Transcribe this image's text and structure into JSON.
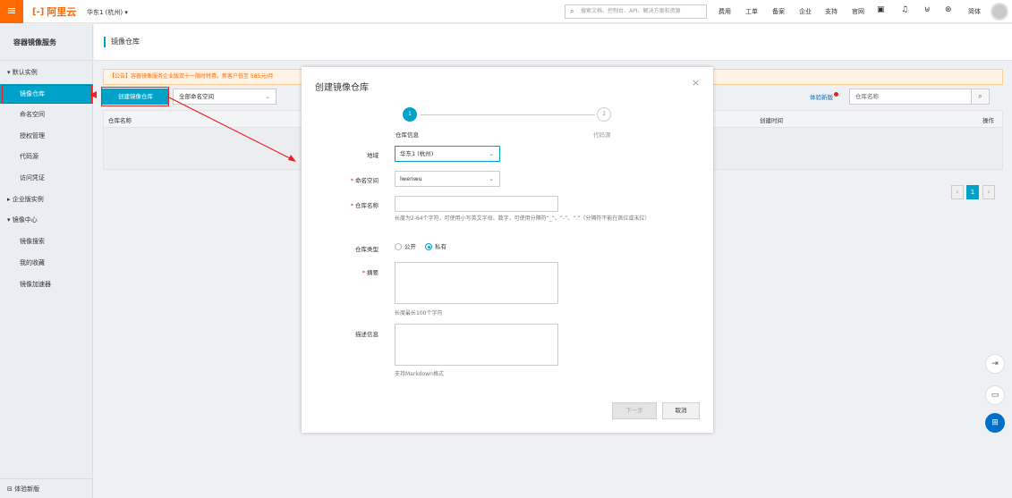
{
  "topbar": {
    "menu_icon": "hamburger-icon",
    "logo_text": "阿里云",
    "region": "华东1 (杭州)",
    "region_caret": "▾",
    "search_placeholder": "搜索文档、控制台、API、解决方案和资源",
    "nav": [
      "费用",
      "工单",
      "备案",
      "企业",
      "支持",
      "官网"
    ],
    "lang": "简体"
  },
  "sidebar": {
    "title": "容器镜像服务",
    "items": [
      {
        "label": "▾ 默认实例",
        "type": "group"
      },
      {
        "label": "镜像仓库",
        "type": "sub",
        "active": true
      },
      {
        "label": "命名空间",
        "type": "sub"
      },
      {
        "label": "授权管理",
        "type": "sub"
      },
      {
        "label": "代码源",
        "type": "sub"
      },
      {
        "label": "访问凭证",
        "type": "sub"
      },
      {
        "label": "▸ 企业版实例",
        "type": "group"
      },
      {
        "label": "▾ 镜像中心",
        "type": "group"
      },
      {
        "label": "镜像搜索",
        "type": "sub"
      },
      {
        "label": "我的收藏",
        "type": "sub"
      },
      {
        "label": "镜像加速器",
        "type": "sub"
      }
    ],
    "footer": "体验新版"
  },
  "main": {
    "page_title": "镜像仓库",
    "notice": "【公告】容器镜像服务企业版双十一限时特惠，新客户低至 585元/月",
    "create_button": "创建镜像仓库",
    "namespace_select": "全部命名空间",
    "try_new": "体验新版",
    "search_placeholder": "仓库名称",
    "table_headers": {
      "name": "仓库名称",
      "created": "创建时间",
      "actions": "操作"
    },
    "pager": {
      "prev": "‹",
      "current": "1",
      "next": "›"
    }
  },
  "modal": {
    "title": "创建镜像仓库",
    "close": "×",
    "steps": [
      {
        "num": "1",
        "label": "仓库信息"
      },
      {
        "num": "2",
        "label": "代码源"
      }
    ],
    "fields": {
      "region_label": "地域",
      "region_value": "华东1 (杭州)",
      "namespace_label": "命名空间",
      "namespace_value": "lwenwu",
      "repo_name_label": "仓库名称",
      "repo_name_hint": "长度为2-64个字符，可使用小写英文字母、数字，可使用分隔符“_”、“-”、“.”（分隔符不能在首位或末位）",
      "repo_type_label": "仓库类型",
      "repo_type_public": "公开",
      "repo_type_private": "私有",
      "repo_type_selected": "私有",
      "summary_label": "摘要",
      "summary_hint": "长度最长100个字符",
      "desc_label": "描述信息",
      "desc_hint": "支持Markdown格式"
    },
    "next_button": "下一步",
    "cancel_button": "取消"
  },
  "colors": {
    "brand_orange": "#ff6a00",
    "accent_blue": "#00a2ca",
    "annotation_red": "#e6231f"
  },
  "icons": {
    "search": "search-icon",
    "bell": "bell-icon",
    "cart": "cart-icon",
    "help": "help-icon",
    "mail": "mail-icon",
    "close": "close-icon",
    "chevron": "chevron-down-icon"
  }
}
